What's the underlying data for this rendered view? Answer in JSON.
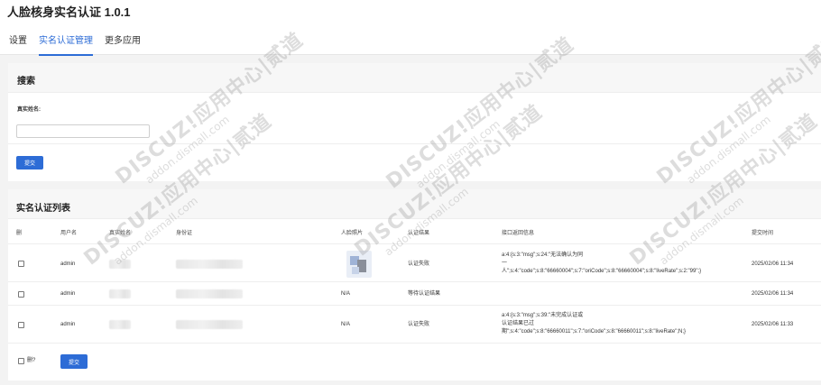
{
  "app": {
    "title": "人脸核身实名认证 1.0.1"
  },
  "tabs": [
    {
      "label": "设置",
      "active": false
    },
    {
      "label": "实名认证管理",
      "active": true
    },
    {
      "label": "更多应用",
      "active": false
    }
  ],
  "search": {
    "title": "搜索",
    "name_label": "真实姓名:",
    "name_value": "",
    "submit_label": "提交"
  },
  "list": {
    "title": "实名认证列表",
    "columns": [
      "删",
      "用户名",
      "真实姓名",
      "身份证",
      "人脸照片",
      "认证结果",
      "接口返回信息",
      "提交时间"
    ],
    "rows": [
      {
        "username": "admin",
        "photo": "",
        "result": "认证失败",
        "api_info": [
          "a:4:{s:3:\"msg\";s:24:\"无法确认为同",
          "一",
          "人\";s:4:\"code\";s:8:\"66660004\";s:7:\"oriCode\";s:8:\"66660004\";s:8:\"liveRate\";s:2:\"99\";}"
        ],
        "time": "2025/02/06 11:34"
      },
      {
        "username": "admin",
        "photo": "N/A",
        "result": "等待认证结果",
        "api_info": [],
        "time": "2025/02/06 11:34"
      },
      {
        "username": "admin",
        "photo": "N/A",
        "result": "认证失败",
        "api_info": [
          "a:4:{s:3:\"msg\";s:39:\"未完成认证或",
          "认证结果已过",
          "期\";s:4:\"code\";s:8:\"66660011\";s:7:\"oriCode\";s:8:\"66660011\";s:8:\"liveRate\";N;}"
        ],
        "time": "2025/02/06 11:33"
      }
    ],
    "footer": {
      "delete_label": "删?",
      "submit_label": "提交"
    }
  },
  "watermark": {
    "text": "DISCUZ!应用中心|贰道",
    "url": "addon.dismall.com"
  },
  "colors": {
    "accent": "#2d6cd6",
    "panel_bg": "#ffffff",
    "page_bg": "#f3f3f3"
  }
}
